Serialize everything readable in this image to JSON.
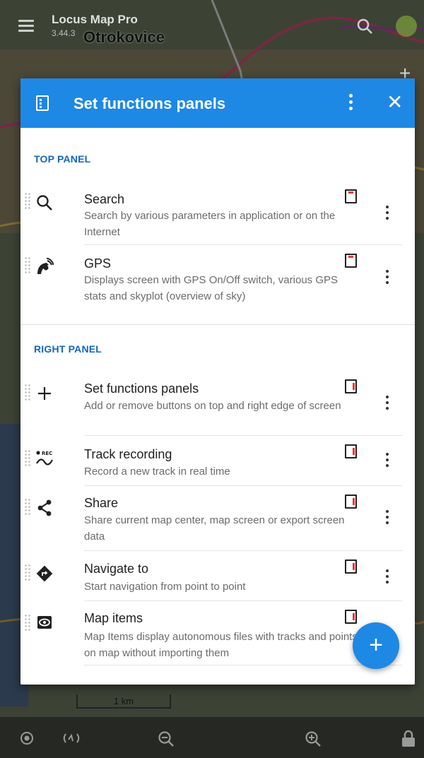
{
  "app": {
    "title": "Locus Map Pro",
    "version": "3.44.3",
    "location": "Otrokovice"
  },
  "map": {
    "scale_label": "1 km"
  },
  "dialog": {
    "title": "Set functions panels",
    "accent_color": "#1e88e5",
    "sections": [
      {
        "title": "TOP PANEL",
        "items": [
          {
            "icon": "search-icon",
            "title": "Search",
            "description": "Search by various parameters in application or on the Internet",
            "panel": "top"
          },
          {
            "icon": "gps-icon",
            "title": "GPS",
            "description": "Displays screen with GPS On/Off switch, various GPS stats and skyplot (overview of sky)",
            "panel": "top"
          }
        ]
      },
      {
        "title": "RIGHT PANEL",
        "items": [
          {
            "icon": "plus-icon",
            "title": "Set functions panels",
            "description": "Add or remove buttons on top and right edge of screen",
            "panel": "right"
          },
          {
            "icon": "track-recording-icon",
            "title": "Track recording",
            "description": "Record a new track in real time",
            "panel": "right"
          },
          {
            "icon": "share-icon",
            "title": "Share",
            "description": "Share current map center, map screen or export screen data",
            "panel": "right"
          },
          {
            "icon": "navigate-icon",
            "title": "Navigate to",
            "description": "Start navigation from point to point",
            "panel": "right"
          },
          {
            "icon": "map-items-icon",
            "title": "Map items",
            "description": "Map Items display autonomous files with tracks and points on map without importing them",
            "panel": "right"
          }
        ]
      }
    ],
    "rec_badge": "REC"
  }
}
